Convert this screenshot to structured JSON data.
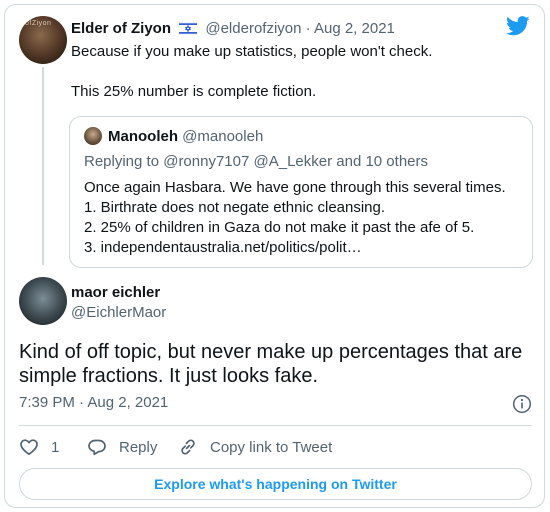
{
  "parent_tweet": {
    "author_name": "Elder of Ziyon",
    "author_handle": "@elderofziyon",
    "separator": "·",
    "date": "Aug 2, 2021",
    "avatar_text": "ofZiyon",
    "text_line1": "Because if you make up statistics, people won't check.",
    "text_line2": "This 25% number is complete fiction.",
    "flag_icon": "israel-flag-icon"
  },
  "quoted_tweet": {
    "author_name": "Manooleh",
    "author_handle": "@manooleh",
    "replying_to": "Replying to @ronny7107 @A_Lekker and 10 others",
    "lines": [
      "Once again Hasbara.  We have gone through this several times.",
      "1. Birthrate does not negate ethnic cleansing.",
      "2. 25% of children in Gaza do not make it past the afe of 5.",
      "3. independentaustralia.net/politics/polit…"
    ]
  },
  "main_tweet": {
    "author_name": "maor eichler",
    "author_handle": "@EichlerMaor",
    "text": "Kind of off topic, but never make up percentages that are simple fractions. It just looks fake.",
    "timestamp": "7:39 PM · Aug 2, 2021"
  },
  "actions": {
    "like_count": "1",
    "reply_label": "Reply",
    "copy_link_label": "Copy link to Tweet"
  },
  "explore_label": "Explore what's happening on Twitter",
  "colors": {
    "accent": "#1d9bf0",
    "secondary_text": "#536471",
    "border": "#cfd9de",
    "like_icon": "#f91880"
  }
}
